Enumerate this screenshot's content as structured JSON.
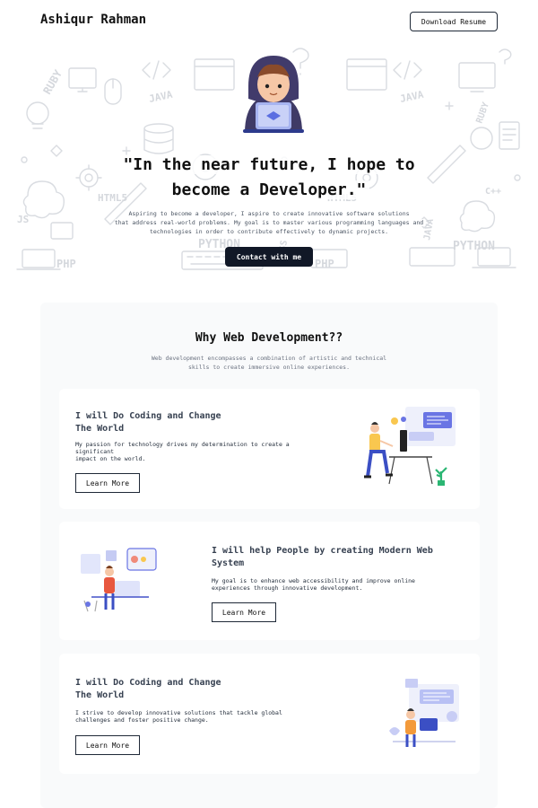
{
  "header": {
    "brand": "Ashiqur Rahman",
    "download_label": "Download Resume"
  },
  "hero": {
    "quote_line1": "\"In the near future, I hope to",
    "quote_line2": "become a Developer.\"",
    "sub_line1": "Aspiring to become a developer, I aspire to create innovative software solutions",
    "sub_line2": "that address real-world problems. My goal is to master various programming languages and",
    "sub_line3": "technologies in order to contribute effectively to dynamic projects.",
    "contact_label": "Contact with me",
    "doodle_words": [
      "RUBY",
      "JAVA",
      "JAVA",
      "HTML5",
      "HTML5",
      "C++",
      "JS",
      "PYTHON",
      "PYTHON",
      "PHP",
      "PHP",
      "CSS",
      "JAVA",
      "RUBY"
    ]
  },
  "why": {
    "title": "Why Web Development??",
    "desc_line1": "Web development encompasses a combination of artistic and technical",
    "desc_line2": "skills to create immersive online experiences.",
    "cards": [
      {
        "title_line1": "I will Do Coding and Change",
        "title_line2": "The World",
        "text_line1": "My passion for technology drives my determination to create a",
        "text_line2": "significant",
        "text_line3": "impact on the world.",
        "button": "Learn More"
      },
      {
        "title_line1": "I will help People by creating Modern Web",
        "title_line2": "System",
        "text_line1": "My goal is to enhance web accessibility and improve online",
        "text_line2": "experiences through innovative development.",
        "button": "Learn More"
      },
      {
        "title_line1": "I will Do Coding and Change",
        "title_line2": "The World",
        "text_line1": "I strive to develop innovative solutions that tackle global",
        "text_line2": "challenges and foster positive change.",
        "button": "Learn More"
      }
    ]
  },
  "colors": {
    "dark": "#111827",
    "doodle": "#d1d5db",
    "accent_blue": "#6366f1",
    "accent_orange": "#f59e0b"
  }
}
